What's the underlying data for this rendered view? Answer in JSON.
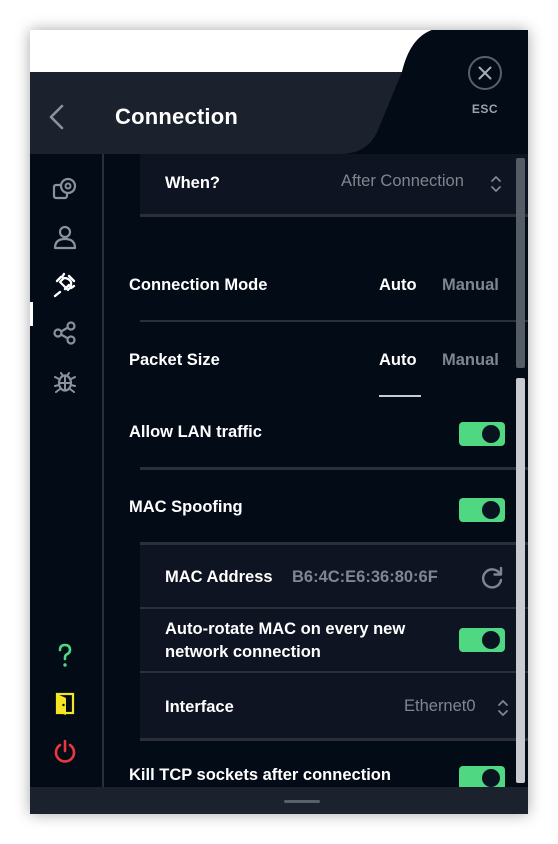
{
  "header": {
    "title": "Connection",
    "esc_label": "ESC"
  },
  "sidebar": {
    "items": [
      {
        "icon": "servers-icon"
      },
      {
        "icon": "account-icon"
      },
      {
        "icon": "plug-icon",
        "active": true
      },
      {
        "icon": "share-icon"
      },
      {
        "icon": "bug-icon"
      }
    ],
    "bottom": [
      {
        "icon": "help-icon",
        "color": "#4fd782"
      },
      {
        "icon": "exit-door-icon",
        "color": "#f5e623"
      },
      {
        "icon": "power-icon",
        "color": "#e8383d"
      }
    ]
  },
  "settings": {
    "when": {
      "label": "When?",
      "value": "After Connection"
    },
    "connection_mode": {
      "label": "Connection Mode",
      "options": [
        "Auto",
        "Manual"
      ],
      "selected": "Auto"
    },
    "packet_size": {
      "label": "Packet Size",
      "options": [
        "Auto",
        "Manual"
      ],
      "selected": "Auto"
    },
    "allow_lan": {
      "label": "Allow LAN traffic",
      "on": true
    },
    "mac_spoofing": {
      "label": "MAC Spoofing",
      "on": true
    },
    "mac_address": {
      "label": "MAC Address",
      "value": "B6:4C:E6:36:80:6F"
    },
    "auto_rotate": {
      "label_line1": "Auto-rotate MAC on every new",
      "label_line2": "network connection",
      "on": true
    },
    "interface": {
      "label": "Interface",
      "value": "Ethernet0"
    },
    "kill_tcp": {
      "label": "Kill TCP sockets after connection",
      "on": true
    }
  },
  "colors": {
    "accent_green": "#4fd782",
    "background": "#030b17",
    "panel": "#1b212d"
  }
}
